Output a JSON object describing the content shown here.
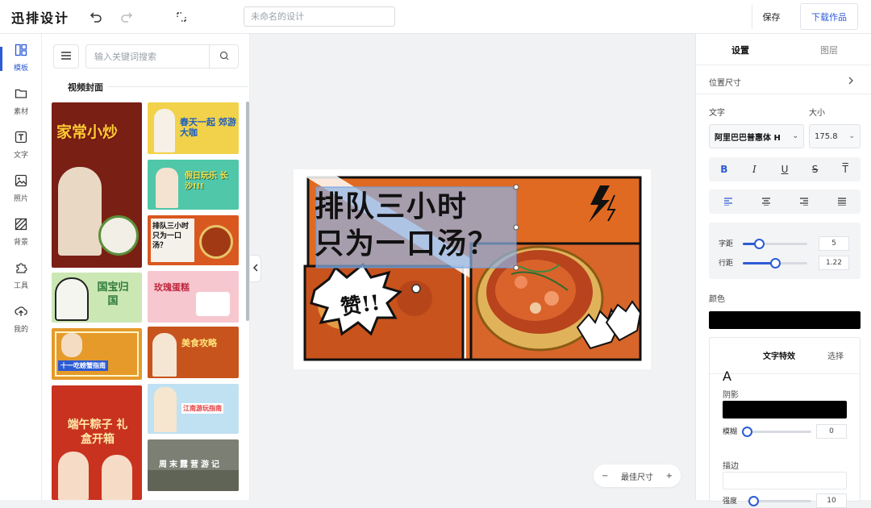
{
  "app": {
    "logo": "迅排设计",
    "title_placeholder": "未命名的设计",
    "save_label": "保存",
    "download_label": "下载作品"
  },
  "leftnav": {
    "items": [
      {
        "label": "模板",
        "icon": "template-icon",
        "active": true
      },
      {
        "label": "素材",
        "icon": "folder-icon",
        "active": false
      },
      {
        "label": "文字",
        "icon": "text-icon",
        "active": false
      },
      {
        "label": "照片",
        "icon": "image-icon",
        "active": false
      },
      {
        "label": "背景",
        "icon": "background-icon",
        "active": false
      },
      {
        "label": "工具",
        "icon": "puzzle-icon",
        "active": false
      },
      {
        "label": "我的",
        "icon": "upload-cloud-icon",
        "active": false
      }
    ]
  },
  "templates": {
    "search_placeholder": "输入关键词搜索",
    "section_label": "视频封面",
    "tiles": [
      {
        "text": "家常小炒",
        "bg": "#7a1f14",
        "fg": "#ffcc33"
      },
      {
        "text": "春天一起 郊游大咖",
        "bg": "#f2d24a",
        "fg": "#1d5fbf"
      },
      {
        "text": "假日玩乐 长沙!!!",
        "bg": "#4fc7a8",
        "fg": "#f9e04a"
      },
      {
        "text": "排队三小时 只为一口汤？",
        "bg": "#d9581f",
        "fg": "#111111"
      },
      {
        "text": "国宝归国",
        "bg": "#cbe7b3",
        "fg": "#2f7a3b"
      },
      {
        "text": "玫瑰蛋糕",
        "bg": "#f7c7d0",
        "fg": "#c0283f"
      },
      {
        "text": "十一吃螃蟹指南",
        "bg": "#e59a2a",
        "fg": "#ffffff"
      },
      {
        "text": "美食攻略",
        "bg": "#c8541d",
        "fg": "#ffe27a"
      },
      {
        "text": "端午粽子 礼盒开箱",
        "bg": "#c8321f",
        "fg": "#ffe9a8"
      },
      {
        "text": "江南游玩指南",
        "bg": "#bfe1f2",
        "fg": "#e23a3a"
      },
      {
        "text": "周末露营游记",
        "bg": "#7c7f74",
        "fg": "#ffffff"
      }
    ]
  },
  "canvas": {
    "headline_line1": "排队三小时",
    "headline_line2": "只为一口汤？",
    "burst_text": "赞!!",
    "zoom_minus": "−",
    "zoom_label": "最佳尺寸",
    "zoom_plus": "+"
  },
  "rpanel": {
    "tab_settings": "设置",
    "tab_layers": "图层",
    "position_size": "位置尺寸",
    "font_label": "文字",
    "size_label": "大小",
    "font_value": "阿里巴巴普惠体 H",
    "size_value": "175.8",
    "letter_spacing_label": "字距",
    "letter_spacing_value": "5",
    "letter_spacing_level": 0.25,
    "line_height_label": "行距",
    "line_height_value": "1.22",
    "line_height_level": 0.5,
    "color_label": "颜色",
    "color_value": "#000000",
    "effects_tab": "文字特效",
    "effects_select": "选择",
    "effects_letter": "A",
    "shadow_label": "阴影",
    "blur_label": "模糊",
    "blur_value": "0",
    "blur_level": 0.0,
    "stroke_label": "描边",
    "strength_label": "强度",
    "strength_value": "10",
    "accent": "#2c5bd6"
  }
}
